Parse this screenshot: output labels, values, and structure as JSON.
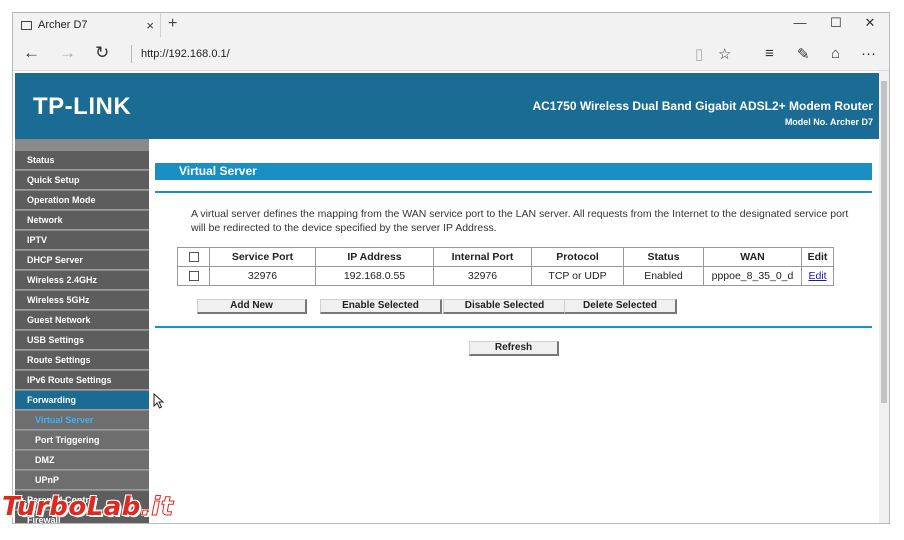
{
  "browser": {
    "tab_title": "Archer D7",
    "tab_close": "×",
    "new_tab": "+",
    "window_controls": {
      "minimize": "—",
      "maximize": "☐",
      "close": "✕"
    },
    "nav": {
      "back": "←",
      "forward": "→",
      "refresh": "↻"
    },
    "url": "http://192.168.0.1/",
    "toolbar_icons": [
      "reading-view-icon",
      "favorites-star-icon",
      "hub-icon",
      "web-note-icon",
      "share-icon",
      "more-icon"
    ],
    "toolbar_glyphs": {
      "reading": "▯",
      "star": "☆",
      "hub": "≡",
      "note": "✎",
      "share": "⌂",
      "more": "···"
    }
  },
  "header": {
    "logo": "TP-LINK",
    "title": "AC1750 Wireless Dual Band Gigabit ADSL2+ Modem Router",
    "model": "Model No. Archer D7"
  },
  "sidebar": {
    "items": [
      {
        "label": "Status"
      },
      {
        "label": "Quick Setup"
      },
      {
        "label": "Operation Mode"
      },
      {
        "label": "Network"
      },
      {
        "label": "IPTV"
      },
      {
        "label": "DHCP Server"
      },
      {
        "label": "Wireless 2.4GHz"
      },
      {
        "label": "Wireless 5GHz"
      },
      {
        "label": "Guest Network"
      },
      {
        "label": "USB Settings"
      },
      {
        "label": "Route Settings"
      },
      {
        "label": "IPv6 Route Settings"
      },
      {
        "label": "Forwarding"
      },
      {
        "label": "Virtual Server"
      },
      {
        "label": "Port Triggering"
      },
      {
        "label": "DMZ"
      },
      {
        "label": "UPnP"
      },
      {
        "label": "Parental Control"
      },
      {
        "label": "Firewall"
      }
    ]
  },
  "main": {
    "section_title": "Virtual Server",
    "description": "A virtual server defines the mapping from the WAN service port to the LAN server. All requests from the Internet to the designated service port will be redirected to the device specified by the server IP Address.",
    "table": {
      "headers": [
        "Service Port",
        "IP Address",
        "Internal Port",
        "Protocol",
        "Status",
        "WAN",
        "Edit"
      ],
      "rows": [
        {
          "service_port": "32976",
          "ip": "192.168.0.55",
          "internal_port": "32976",
          "protocol": "TCP or UDP",
          "status": "Enabled",
          "wan": "pppoe_8_35_0_d",
          "edit": "Edit"
        }
      ]
    },
    "buttons": {
      "add_new": "Add New",
      "enable_selected": "Enable Selected",
      "disable_selected": "Disable Selected",
      "delete_selected": "Delete Selected",
      "refresh": "Refresh"
    }
  },
  "watermark": {
    "text": "TurboLab",
    "suffix": ".it"
  },
  "colors": {
    "brand_blue": "#1a6c95",
    "section_blue": "#1a8fc4",
    "menu_grey": "#5d5d5d",
    "active_link": "#3bb3ff",
    "watermark_red": "#e0281e"
  }
}
